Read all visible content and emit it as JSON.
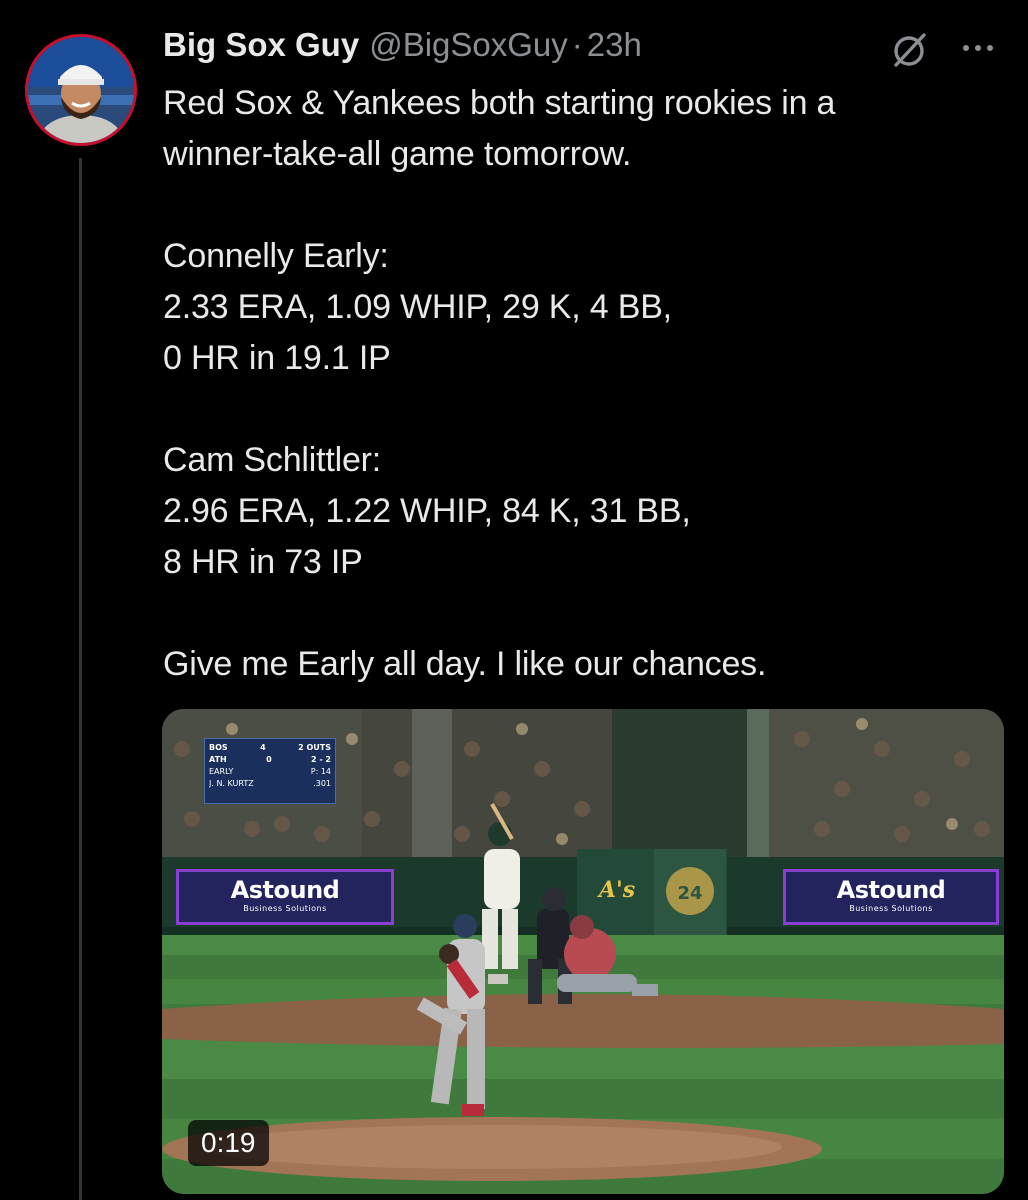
{
  "tweet": {
    "author": {
      "display_name": "Big Sox Guy",
      "handle": "@BigSoxGuy",
      "separator": "·",
      "time": "23h"
    },
    "icons": {
      "grok": "grok-slash-icon",
      "more": "more-options-icon"
    },
    "text": {
      "intro": "Red Sox & Yankees both starting rookies in a\nwinner-take-all game tomorrow.",
      "early": "Connelly Early:\n2.33 ERA, 1.09 WHIP, 29 K, 4 BB,\n0 HR in 19.1 IP",
      "schlittler": "Cam Schlittler:\n2.96 ERA, 1.22 WHIP, 84 K, 31 BB,\n8 HR in 73 IP",
      "closing": "Give me Early all day. I like our chances."
    },
    "media": {
      "type": "video",
      "duration": "0:19",
      "scorebug": {
        "team1": "BOS",
        "score1": "4",
        "team2": "ATH",
        "score2": "0",
        "outs": "2 OUTS",
        "count": "2 - 2",
        "pitcher": "EARLY",
        "pitch_count": "P: 14",
        "batter": "J. N. KURTZ",
        "avg": ".301"
      },
      "ad_left": {
        "brand": "Astound",
        "sub": "Business Solutions"
      },
      "ad_right": {
        "brand": "Astound",
        "sub": "Business Solutions"
      },
      "wall_logo": "A's",
      "retired_number": "24"
    }
  },
  "colors": {
    "background": "#000000",
    "primary_text": "#e7e9ea",
    "secondary_text": "#8b8f94",
    "thread_line": "#333639",
    "avatar_ring": "#c8102e",
    "ad_board": "#23235e",
    "ad_border": "#8a3fd0"
  }
}
